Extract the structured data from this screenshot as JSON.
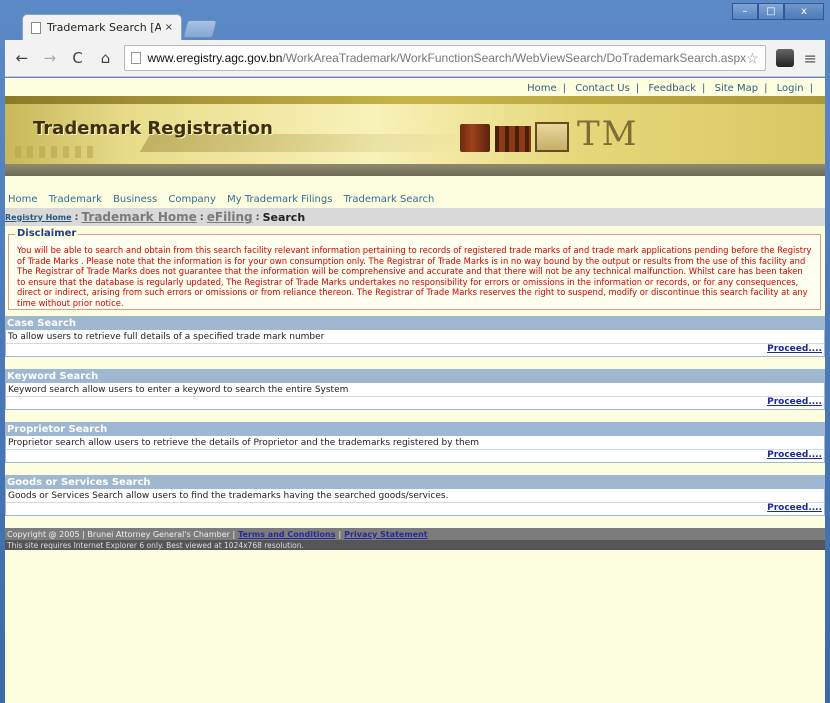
{
  "browser": {
    "tab_title": "Trademark Search [Attorne",
    "tab_close": "×",
    "url_host": "www.eregistry.agc.gov.bn",
    "url_path": "/WorkAreaTrademark/WorkFunctionSearch/WebViewSearch/DoTrademarkSearch.aspx",
    "win_minimize": "–",
    "win_maximize": "□",
    "win_close": "x"
  },
  "toplinks": {
    "items": [
      "Home",
      "Contact Us",
      "Feedback",
      "Site Map",
      "Login"
    ]
  },
  "banner": {
    "title": "Trademark Registration",
    "tm": "TM"
  },
  "mainnav": {
    "items": [
      "Home",
      "Trademark",
      "Business",
      "Company",
      "My Trademark Filings",
      "Trademark Search"
    ]
  },
  "breadcrumb": {
    "registry_home": "Registry Home",
    "trademark_home": "Trademark Home",
    "efiling": "eFiling",
    "current": "Search"
  },
  "disclaimer": {
    "legend": "Disclaimer",
    "text": "You will be able to search and obtain from this search facility relevant information pertaining to records of registered trade marks of and trade mark applications pending before the Registry of Trade Marks . Please note that the information is for your own consumption only. The Registrar of Trade Marks is in no way bound by the output or results from the use of this facility and The Registrar of Trade Marks does not guarantee that the information will be comprehensive and accurate and that there will not be any technical malfunction. Whilst care has been taken to ensure that the database is regularly updated, The Registrar of Trade Marks undertakes no responsibility for errors or omissions in the information or records, or for any consequences, direct or indirect, arising from such errors or omissions or from reliance thereon. The Registrar of Trade Marks reserves the right to suspend, modify or discontinue this search facility at any time without prior notice."
  },
  "sections": [
    {
      "title": "Case Search",
      "desc": "To allow users to retrieve full details of a specified trade mark number",
      "action": "Proceed...."
    },
    {
      "title": "Keyword Search",
      "desc": "Keyword search allow users to enter a keyword to search the entire System",
      "action": "Proceed...."
    },
    {
      "title": "Proprietor Search",
      "desc": "Proprietor search allow users to retrieve the details of Proprietor and the trademarks registered by them",
      "action": "Proceed...."
    },
    {
      "title": "Goods or Services Search",
      "desc": "Goods or Services Search allow users to find the trademarks having the searched goods/services.",
      "action": "Proceed...."
    }
  ],
  "footer": {
    "copyright": "Copyright @ 2005 | Brunei Attorney General's Chamber |",
    "terms": "Terms and Conditions",
    "sep": "|",
    "privacy": "Privacy Statement",
    "requirement": "This site requires Internet Explorer 6 only. Best viewed at 1024x768 resolution."
  }
}
